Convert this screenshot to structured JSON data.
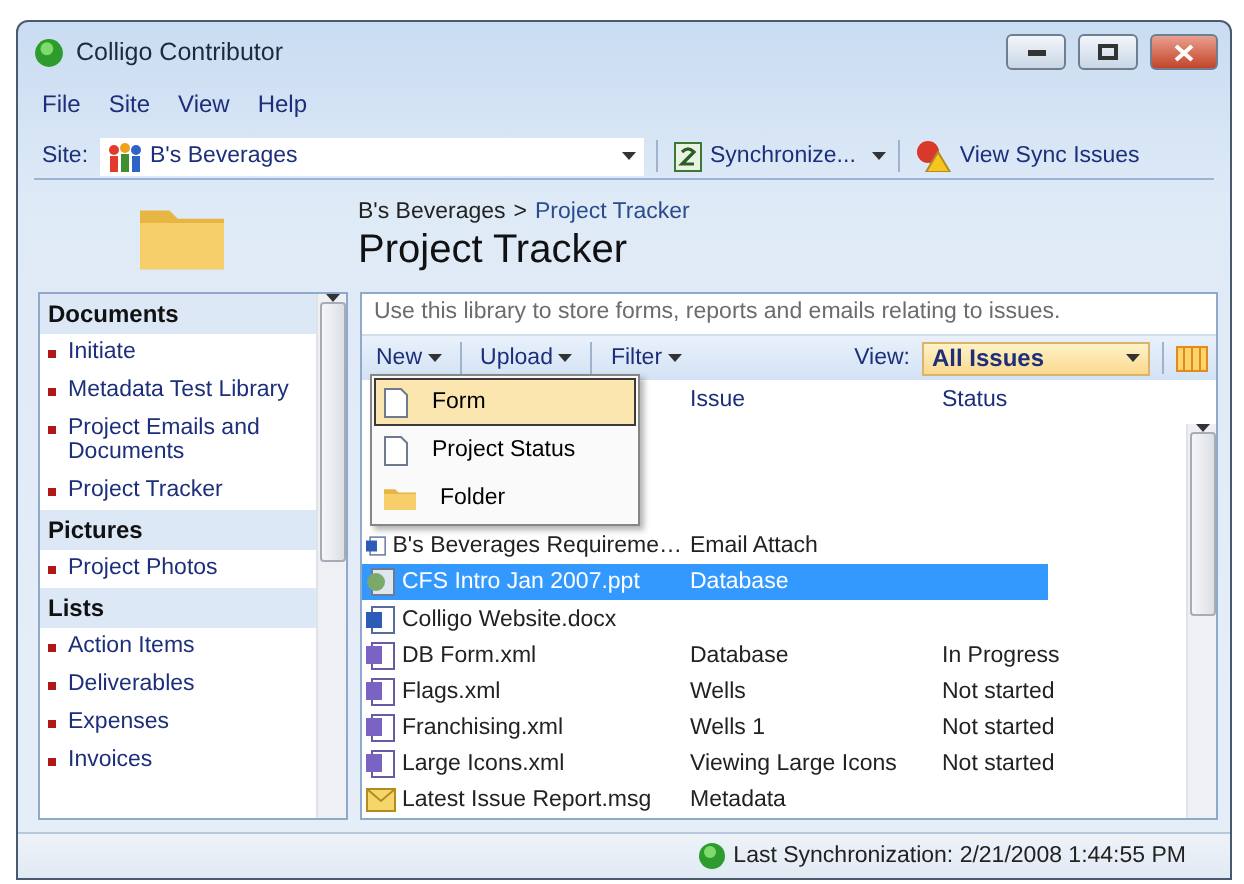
{
  "window": {
    "title": "Colligo Contributor"
  },
  "menu": [
    "File",
    "Site",
    "View",
    "Help"
  ],
  "site_bar": {
    "label": "Site:",
    "site": "B's Beverages",
    "synchronize": "Synchronize...",
    "view_sync_issues": "View Sync Issues"
  },
  "header": {
    "breadcrumb": [
      "B's Beverages",
      "Project Tracker"
    ],
    "separator": ">",
    "title": "Project Tracker"
  },
  "sidebar": {
    "sections": [
      {
        "title": "Documents",
        "items": [
          "Initiate",
          "Metadata Test Library",
          "Project Emails and Documents",
          "Project Tracker"
        ]
      },
      {
        "title": "Pictures",
        "items": [
          "Project Photos"
        ]
      },
      {
        "title": "Lists",
        "items": [
          "Action Items",
          "Deliverables",
          "Expenses",
          "Invoices"
        ]
      }
    ]
  },
  "library": {
    "description": "Use this library to store forms, reports and emails relating to issues.",
    "toolbar": [
      "New",
      "Upload",
      "Filter"
    ],
    "view_label": "View:",
    "view": "All Issues",
    "new_menu": [
      {
        "label": "Form",
        "kind": "file",
        "selected": true
      },
      {
        "label": "Project Status",
        "kind": "file",
        "selected": false
      },
      {
        "label": "Folder",
        "kind": "folder",
        "selected": false
      }
    ],
    "columns": [
      "Issue",
      "Status"
    ],
    "rows": [
      {
        "name": "B's Beverages Requireme…",
        "kind": "word",
        "issue": "Email Attach",
        "selected": false
      },
      {
        "name": "CFS Intro Jan 2007.ppt",
        "kind": "ppt",
        "issue": "Database",
        "selected": true
      },
      {
        "name": "Colligo Website.docx",
        "kind": "word",
        "selected": false
      },
      {
        "name": "DB Form.xml",
        "kind": "xml",
        "issue": "Database",
        "status": "In Progress",
        "selected": false
      },
      {
        "name": "Flags.xml",
        "kind": "xml",
        "issue": "Wells",
        "status": "Not started",
        "selected": false
      },
      {
        "name": "Franchising.xml",
        "kind": "xml",
        "issue": "Wells 1",
        "status": "Not started",
        "selected": false
      },
      {
        "name": "Large Icons.xml",
        "kind": "xml",
        "issue": "Viewing Large Icons",
        "status": "Not started",
        "selected": false
      },
      {
        "name": "Latest Issue Report.msg",
        "kind": "msg",
        "issue": "Metadata",
        "selected": false
      }
    ]
  },
  "status_bar": {
    "text": "Last Synchronization: 2/21/2008 1:44:55 PM"
  }
}
